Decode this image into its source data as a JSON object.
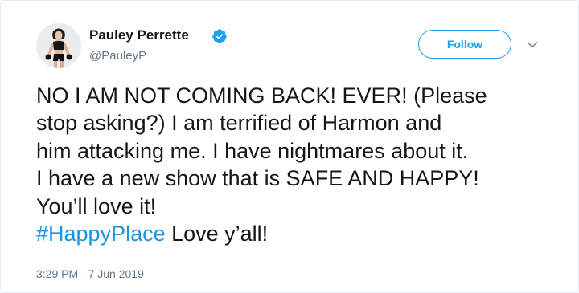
{
  "user": {
    "display_name": "Pauley Perrette",
    "handle": "@PauleyP",
    "verified_icon": "verified-badge-icon",
    "avatar_icon": "profile-photo"
  },
  "actions": {
    "follow_label": "Follow",
    "menu_icon": "chevron-down-icon"
  },
  "tweet": {
    "lines": [
      "NO I AM NOT COMING BACK! EVER!  (Please",
      "stop asking?) I am terrified of Harmon and",
      "him attacking me. I have nightmares about it.",
      "I have a new show that is SAFE AND HAPPY!",
      "You’ll love it!"
    ],
    "hashtag": "#HappyPlace",
    "after_hashtag": " Love y’all!",
    "timestamp": "3:29 PM - 7 Jun 2019"
  },
  "colors": {
    "accent": "#1da1f2",
    "hashtag": "#1b95e0",
    "secondary_text": "#657786",
    "primary_text": "#14171a"
  }
}
